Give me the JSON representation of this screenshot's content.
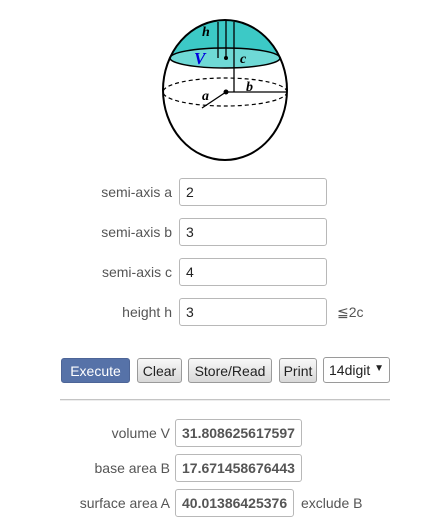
{
  "figure": {
    "label_h": "h",
    "label_V": "V",
    "label_c": "c",
    "label_a": "a",
    "label_b": "b"
  },
  "inputs": [
    {
      "label": "semi-axis a",
      "value": "2"
    },
    {
      "label": "semi-axis b",
      "value": "3"
    },
    {
      "label": "semi-axis c",
      "value": "4"
    },
    {
      "label": "height h",
      "value": "3",
      "suffix": "≦2c"
    }
  ],
  "buttons": {
    "execute": "Execute",
    "clear": "Clear",
    "store_read": "Store/Read",
    "print": "Print"
  },
  "digits_select": "14digit",
  "outputs": [
    {
      "label": "volume V",
      "value": "31.808625617597"
    },
    {
      "label": "base area B",
      "value": "17.671458676443"
    },
    {
      "label": "surface area A",
      "value": "40.01386425376",
      "suffix": "exclude B"
    }
  ],
  "colors": {
    "cap_fill": "#3cc9c6",
    "execute_button": "#5672a8",
    "label_V": "#0000dd"
  }
}
